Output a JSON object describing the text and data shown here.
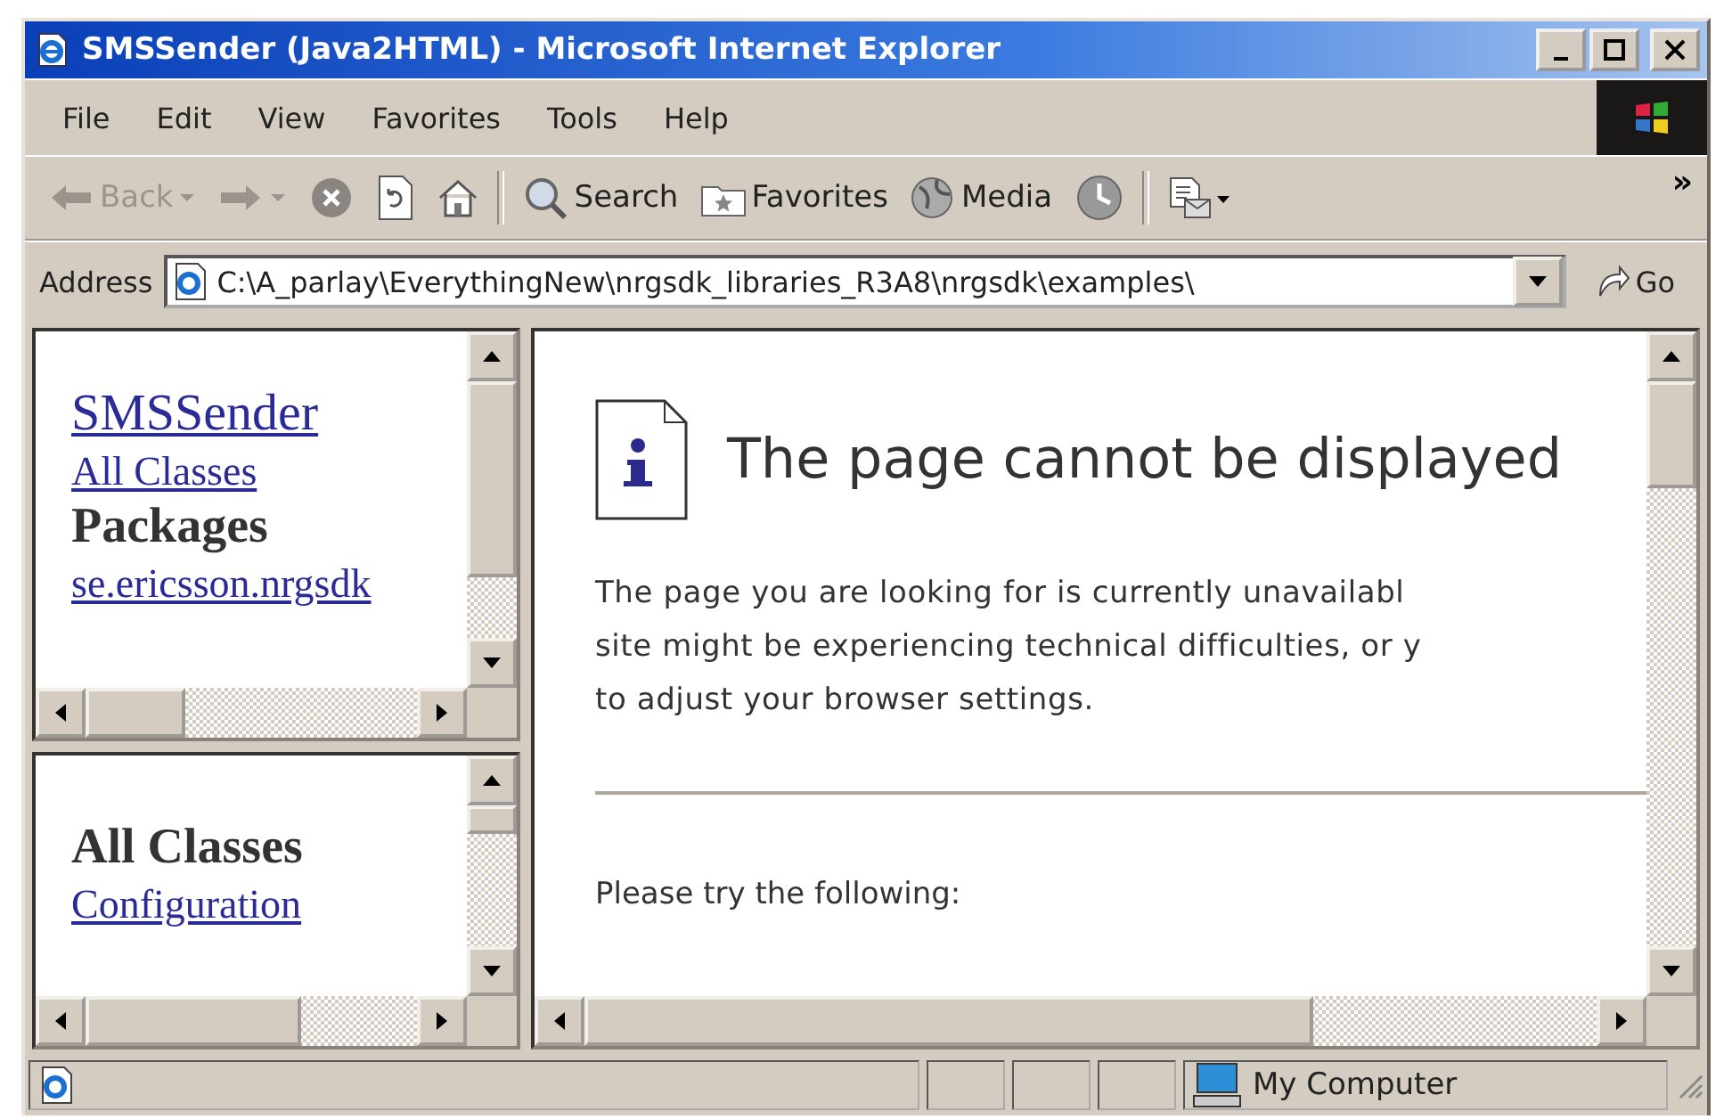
{
  "window": {
    "title": "SMSSender (Java2HTML) - Microsoft Internet Explorer"
  },
  "menu": [
    "File",
    "Edit",
    "View",
    "Favorites",
    "Tools",
    "Help"
  ],
  "toolbar": [
    {
      "kind": "back",
      "label": "Back",
      "disabled": true
    },
    {
      "kind": "forward",
      "disabled": true
    },
    {
      "kind": "stop"
    },
    {
      "kind": "refresh"
    },
    {
      "kind": "home"
    },
    {
      "kind": "separator"
    },
    {
      "kind": "search",
      "label": "Search"
    },
    {
      "kind": "favorites",
      "label": "Favorites"
    },
    {
      "kind": "media",
      "label": "Media"
    },
    {
      "kind": "history"
    },
    {
      "kind": "separator"
    },
    {
      "kind": "mail"
    }
  ],
  "toolbar_more": "»",
  "address": {
    "label": "Address",
    "value": "C:\\A_parlay\\EverythingNew\\nrgsdk_libraries_R3A8\\nrgsdk\\examples\\",
    "go": "Go"
  },
  "top_frame": {
    "title": "SMSSender",
    "links": [
      "All Classes"
    ],
    "heading": "Packages",
    "packages": [
      "se.ericsson.nrgsdk"
    ]
  },
  "bottom_frame": {
    "heading": "All Classes",
    "classes": [
      "Configuration"
    ]
  },
  "error_page": {
    "heading": "The page cannot be displayed",
    "paragraph": [
      "The page you are looking for is currently unavailabl",
      "site might be experiencing technical difficulties, or y",
      "to adjust your browser settings."
    ],
    "try": "Please try the following:"
  },
  "status_bar": {
    "zone": "My Computer"
  }
}
